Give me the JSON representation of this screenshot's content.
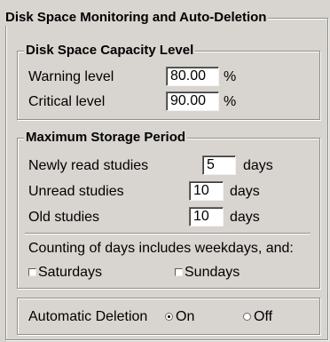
{
  "panel_title": "Disk Space Monitoring and Auto-Deletion",
  "capacity": {
    "title": "Disk Space Capacity Level",
    "warning_label": "Warning level",
    "warning_value": "80.00",
    "critical_label": "Critical level",
    "critical_value": "90.00",
    "unit": "%"
  },
  "storage": {
    "title": "Maximum Storage Period",
    "newly_read_label": "Newly read studies",
    "newly_read_value": "5",
    "unread_label": "Unread studies",
    "unread_value": "10",
    "old_label": "Old studies",
    "old_value": "10",
    "unit": "days",
    "counting_text": "Counting of days includes weekdays, and:",
    "saturdays_label": "Saturdays",
    "saturdays_checked": false,
    "sundays_label": "Sundays",
    "sundays_checked": false
  },
  "auto_deletion": {
    "label": "Automatic Deletion",
    "on_label": "On",
    "off_label": "Off",
    "selected": "On"
  }
}
